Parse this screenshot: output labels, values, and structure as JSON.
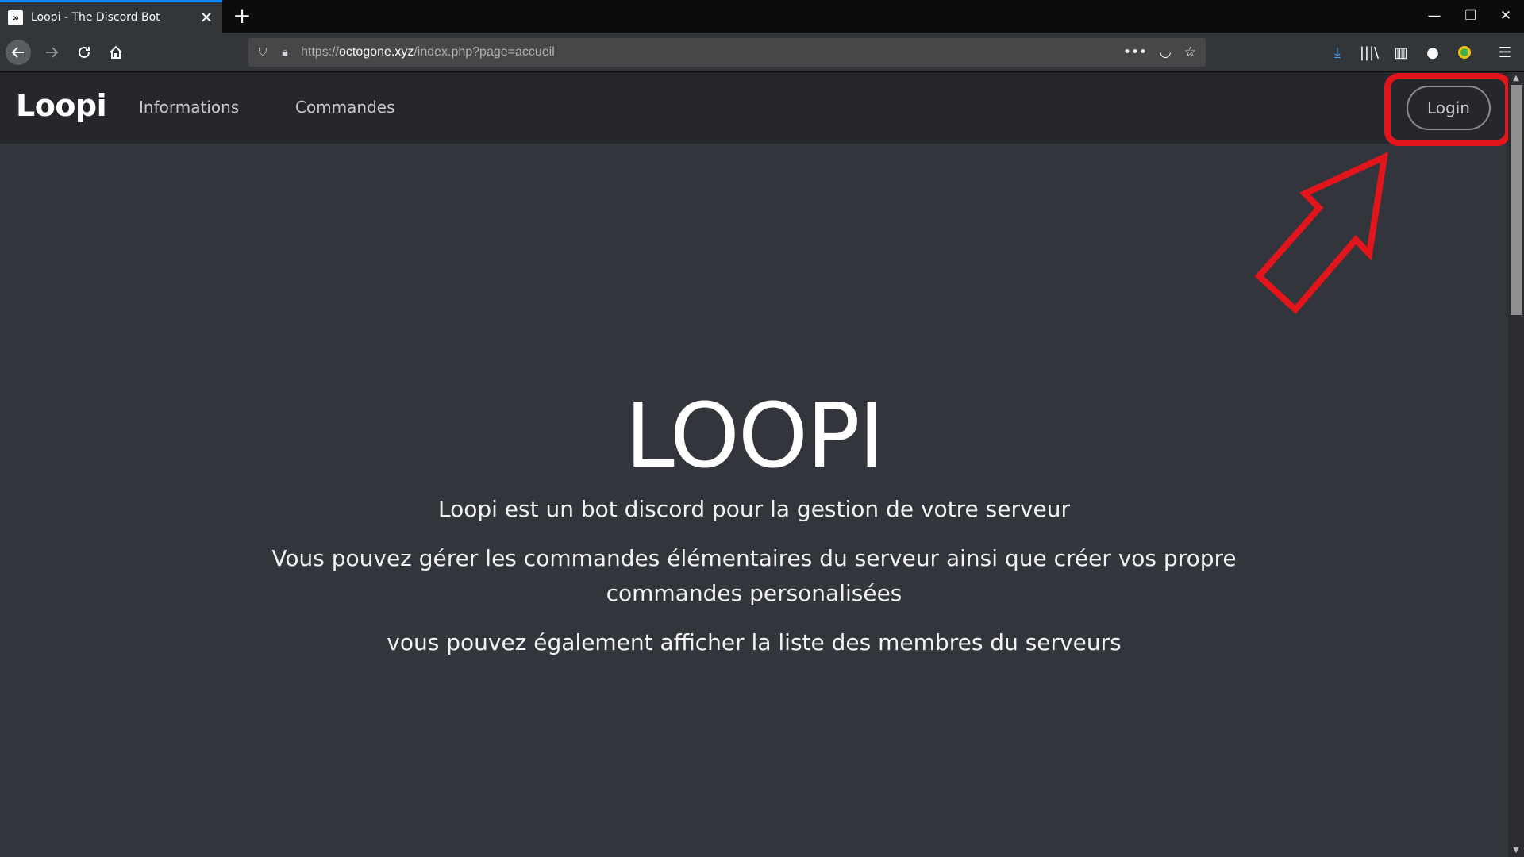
{
  "browser": {
    "tab_title": "Loopi - The Discord Bot",
    "favicon_text": "∞",
    "new_tab_label": "+",
    "url_scheme": "https://",
    "url_host": "octogone.xyz",
    "url_path": "/index.php?page=accueil"
  },
  "site": {
    "brand": "Loopi",
    "nav_links": [
      "Informations",
      "Commandes"
    ],
    "login_label": "Login"
  },
  "hero": {
    "title": "LOOPI",
    "line1": "Loopi est un bot discord pour la gestion de votre serveur",
    "line2": "Vous pouvez gérer les commandes élémentaires du serveur ainsi que créer vos propre commandes personalisées",
    "line3": "vous pouvez également afficher la liste des membres du serveurs"
  },
  "annotation": {
    "color": "#e3151c",
    "target": "login-button"
  },
  "colors": {
    "page_bg": "#32353b",
    "nav_bg": "#25272c",
    "accent_tab": "#0a84ff"
  }
}
